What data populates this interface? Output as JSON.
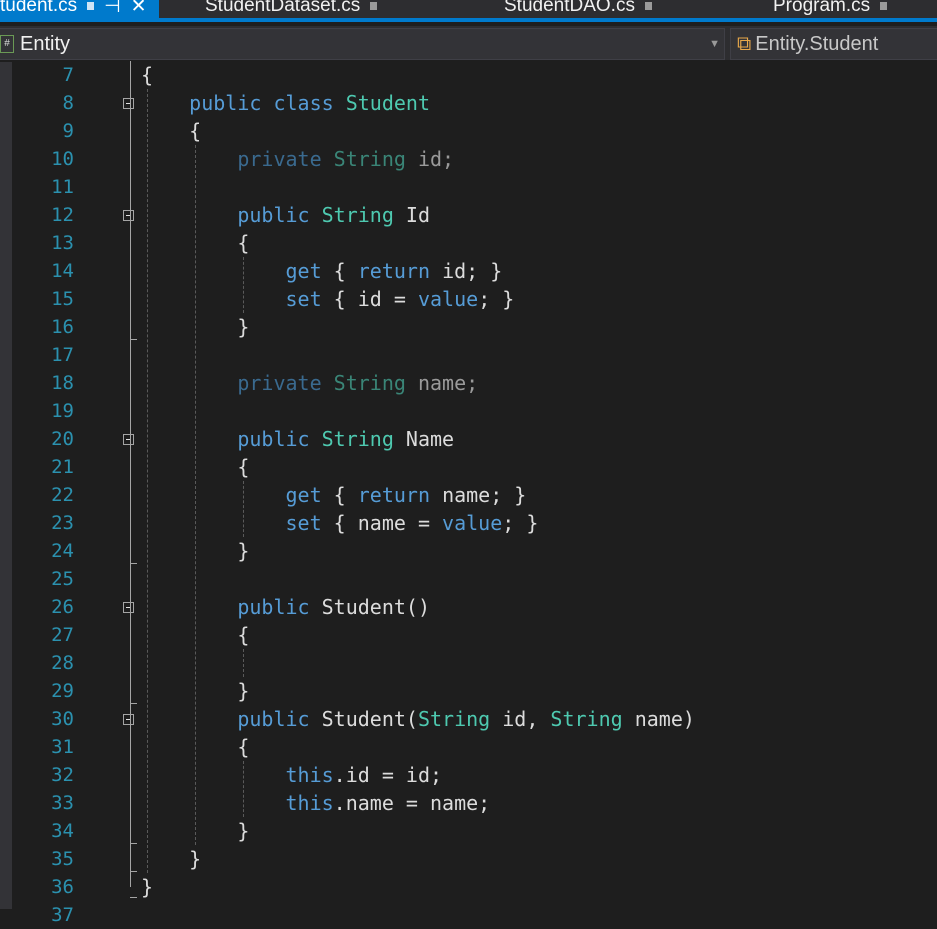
{
  "tabs": [
    {
      "label": "tudent.cs",
      "active": true
    },
    {
      "label": "StudentDataset.cs"
    },
    {
      "label": "StudentDAO.cs"
    },
    {
      "label": "Program.cs"
    }
  ],
  "nav": {
    "project": "Entity",
    "type": "Entity.Student"
  },
  "first_line": 7,
  "lines": [
    [
      [
        "{",
        "pl"
      ]
    ],
    [
      [
        "    "
      ],
      [
        "public class ",
        "kw"
      ],
      [
        "Student",
        "ty"
      ]
    ],
    [
      [
        "    {",
        "pl"
      ]
    ],
    [
      [
        "        "
      ],
      [
        "private ",
        "kw"
      ],
      [
        "String ",
        "ty"
      ],
      [
        "id;",
        "pl"
      ]
    ],
    [],
    [
      [
        "        "
      ],
      [
        "public ",
        "kw"
      ],
      [
        "String ",
        "ty"
      ],
      [
        "Id",
        "pl"
      ]
    ],
    [
      [
        "        {",
        "pl"
      ]
    ],
    [
      [
        "            "
      ],
      [
        "get ",
        "kw"
      ],
      [
        "{ ",
        "pl"
      ],
      [
        "return ",
        "kw"
      ],
      [
        "id; }",
        "pl"
      ]
    ],
    [
      [
        "            "
      ],
      [
        "set ",
        "kw"
      ],
      [
        "{ id = ",
        "pl"
      ],
      [
        "value",
        "kw"
      ],
      [
        "; }",
        "pl"
      ]
    ],
    [
      [
        "        }",
        "pl"
      ]
    ],
    [],
    [
      [
        "        "
      ],
      [
        "private ",
        "kw"
      ],
      [
        "String ",
        "ty"
      ],
      [
        "name;",
        "pl"
      ]
    ],
    [],
    [
      [
        "        "
      ],
      [
        "public ",
        "kw"
      ],
      [
        "String ",
        "ty"
      ],
      [
        "Name",
        "pl"
      ]
    ],
    [
      [
        "        {",
        "pl"
      ]
    ],
    [
      [
        "            "
      ],
      [
        "get ",
        "kw"
      ],
      [
        "{ ",
        "pl"
      ],
      [
        "return ",
        "kw"
      ],
      [
        "name; }",
        "pl"
      ]
    ],
    [
      [
        "            "
      ],
      [
        "set ",
        "kw"
      ],
      [
        "{ name = ",
        "pl"
      ],
      [
        "value",
        "kw"
      ],
      [
        "; }",
        "pl"
      ]
    ],
    [
      [
        "        }",
        "pl"
      ]
    ],
    [],
    [
      [
        "        "
      ],
      [
        "public ",
        "kw"
      ],
      [
        "Student()",
        "pl"
      ]
    ],
    [
      [
        "        {",
        "pl"
      ]
    ],
    [],
    [
      [
        "        }",
        "pl"
      ]
    ],
    [
      [
        "        "
      ],
      [
        "public ",
        "kw"
      ],
      [
        "Student(",
        "pl"
      ],
      [
        "String ",
        "ty"
      ],
      [
        "id, ",
        "pl"
      ],
      [
        "String ",
        "ty"
      ],
      [
        "name)",
        "pl"
      ]
    ],
    [
      [
        "        {",
        "pl"
      ]
    ],
    [
      [
        "            "
      ],
      [
        "this",
        "kw"
      ],
      [
        ".id = id;",
        "pl"
      ]
    ],
    [
      [
        "            "
      ],
      [
        "this",
        "kw"
      ],
      [
        ".name = name;",
        "pl"
      ]
    ],
    [
      [
        "        }",
        "pl"
      ]
    ],
    [
      [
        "    }",
        "pl"
      ]
    ],
    [
      [
        "}",
        "pl"
      ]
    ],
    []
  ],
  "dim_lines": [
    10,
    18
  ],
  "fold_lines": [
    8,
    12,
    20,
    26,
    30
  ]
}
